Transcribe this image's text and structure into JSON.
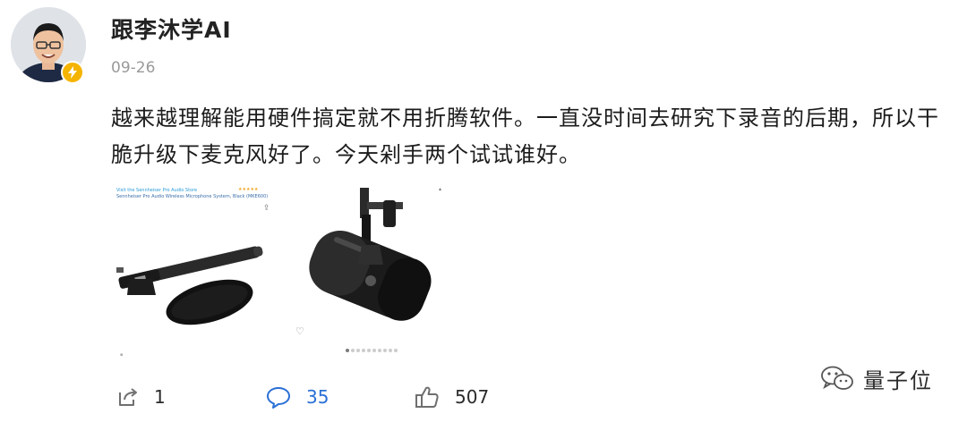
{
  "post": {
    "author": "跟李沐学AI",
    "time": "09-26",
    "text": "越来越理解能用硬件搞定就不用折腾软件。一直没时间去研究下录音的后期，所以干脆升级下麦克风好了。今天剁手两个试试谁好。"
  },
  "product_image": {
    "store_line": "Visit the Sennheiser Pro Audio Store",
    "product_line": "Sennheiser Pro Audio Wireless Microphone System, Black (MKE600)",
    "rating": "★★★★★"
  },
  "actions": {
    "reposts": "1",
    "comments": "35",
    "likes": "507"
  },
  "watermark": {
    "text": "量子位"
  },
  "colors": {
    "badge": "#f5b400",
    "comment_accent": "#2a6fd6",
    "muted_text": "#9a9a9a"
  },
  "icons": {
    "avatar_badge": "lightning-bolt-icon",
    "repost": "repost-icon",
    "comment": "comment-bubble-icon",
    "like": "thumbs-up-icon",
    "watermark": "wechat-logo-icon"
  }
}
